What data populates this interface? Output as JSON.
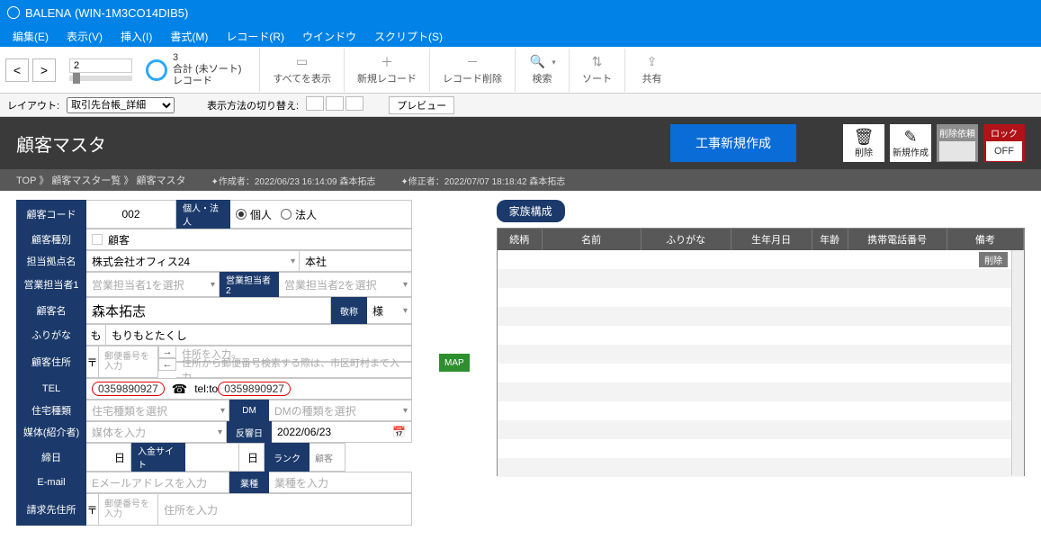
{
  "titlebar": {
    "app": "BALENA",
    "host": "(WIN-1M3CO14DIB5)"
  },
  "menubar": [
    "編集(E)",
    "表示(V)",
    "挿入(I)",
    "書式(M)",
    "レコード(R)",
    "ウインドウ",
    "スクリプト(S)"
  ],
  "toolbar": {
    "page_input": "2",
    "total": "3",
    "total_label": "合計 (未ソート)",
    "record_label": "レコード",
    "groups": {
      "show_all": "すべてを表示",
      "new_record": "新規レコード",
      "delete_record": "レコード削除",
      "search": "検索",
      "sort": "ソート",
      "share": "共有"
    }
  },
  "layoutrow": {
    "layout_label": "レイアウト:",
    "layout_value": "取引先台帳_詳細",
    "switch_label": "表示方法の切り替え:",
    "preview": "プレビュー"
  },
  "darkhead": {
    "title": "顧客マスタ",
    "new_job": "工事新規作成",
    "delete": "削除",
    "create": "新規作成",
    "del_request": "削除依頼",
    "lock": "ロック",
    "lock_state": "OFF"
  },
  "crumb": {
    "path": "TOP 》 顧客マスター覧 》 顧客マスタ",
    "creator_label": "✦作成者：",
    "creator": "2022/06/23  16:14:09   森本拓志",
    "modifier_label": "✦修正者：",
    "modifier": "2022/07/07  18:18:42   森本拓志"
  },
  "form": {
    "code_label": "顧客コード",
    "code": "002",
    "indiv_corp_label": "個人・法人",
    "radio_indiv": "個人",
    "radio_corp": "法人",
    "type_label": "顧客種別",
    "type": "顧客",
    "branch_label": "担当拠点名",
    "branch": "株式会社オフィス24",
    "branch_hq": "本社",
    "sales1_label": "営業担当者1",
    "sales1_ph": "営業担当者1を選択",
    "sales2_label": "営業担当者2",
    "sales2_ph": "営業担当者2を選択",
    "name_label": "顧客名",
    "name": "森本拓志",
    "honor_label": "敬称",
    "honor": "様",
    "kana_label": "ふりがな",
    "kana_prefix": "も",
    "kana": "もりもとたくし",
    "addr_label": "顧客住所",
    "postal_mark": "〒",
    "postal_ph": "郵便番号を入力",
    "addr_ph1": "住所を入力。",
    "addr_ph2": "住所から郵便番号検索する際は、市区町村まで入力。",
    "tel_label": "TEL",
    "tel": "0359890927",
    "tel_prefix": "tel:to",
    "tel2": "0359890927",
    "house_label": "住宅種類",
    "house_ph": "住宅種類を選択",
    "dm_label": "DM",
    "dm_ph": "DMの種類を選択",
    "media_label": "媒体(紹介者)",
    "media_ph": "媒体を入力",
    "resp_label": "反響日",
    "resp": "2022/06/23",
    "close_label": "締日",
    "close_suffix": "日",
    "paysite_label": "入金サイト",
    "pay_suffix": "日",
    "rank_label": "ランク",
    "rank_side": "顧客",
    "email_label": "E-mail",
    "email_ph": "Eメールアドレスを入力",
    "biz_label": "業種",
    "biz_ph": "業種を入力",
    "billaddr_label": "請求先住所",
    "billaddr_ph": "住所を入力"
  },
  "map_badge": "MAP",
  "family": {
    "tag": "家族構成",
    "cols": [
      "続柄",
      "名前",
      "ふりがな",
      "生年月日",
      "年齢",
      "携帯電話番号",
      "備考"
    ],
    "delete": "削除"
  }
}
